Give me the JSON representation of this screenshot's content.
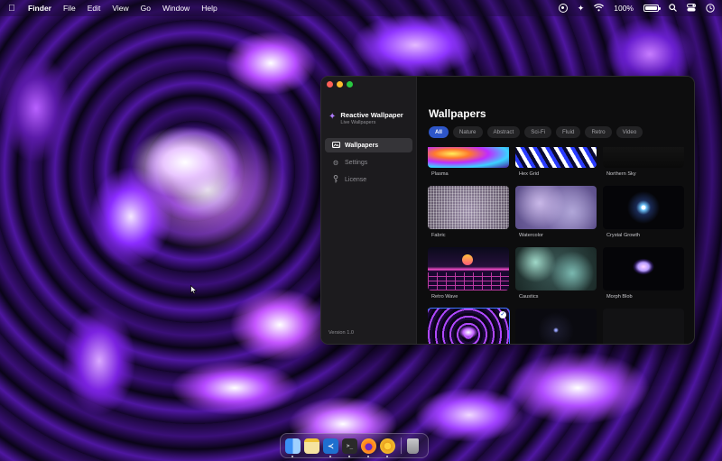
{
  "menubar": {
    "app_name": "Finder",
    "menus": [
      "File",
      "Edit",
      "View",
      "Go",
      "Window",
      "Help"
    ],
    "battery": "100%"
  },
  "app": {
    "brand_title": "Reactive Wallpaper",
    "brand_subtitle": "Live Wallpapers",
    "nav": [
      {
        "label": "Wallpapers",
        "icon": "wallpaper-icon",
        "active": true
      },
      {
        "label": "Settings",
        "icon": "gear-icon",
        "active": false
      },
      {
        "label": "License",
        "icon": "key-icon",
        "active": false
      }
    ],
    "version": "Version 1.0",
    "main_title": "Wallpapers",
    "filters": [
      "All",
      "Nature",
      "Abstract",
      "Sci-Fi",
      "Fluid",
      "Retro",
      "Video"
    ],
    "active_filter": "All",
    "cards": [
      {
        "label": "Plasma"
      },
      {
        "label": "Hex Grid"
      },
      {
        "label": "Northern Sky"
      },
      {
        "label": "Fabric"
      },
      {
        "label": "Watercolor"
      },
      {
        "label": "Crystal Growth"
      },
      {
        "label": "Retro Wave"
      },
      {
        "label": "Caustics"
      },
      {
        "label": "Morph Blob"
      }
    ]
  },
  "dock": {
    "apps": [
      "finder",
      "notes",
      "vscode",
      "terminal",
      "firefox",
      "chrome",
      "trash"
    ]
  },
  "colors": {
    "accent": "#2e56c8",
    "selection": "#3d73ff",
    "window_bg": "#101010",
    "sidebar_bg": "#1c1b1e"
  }
}
